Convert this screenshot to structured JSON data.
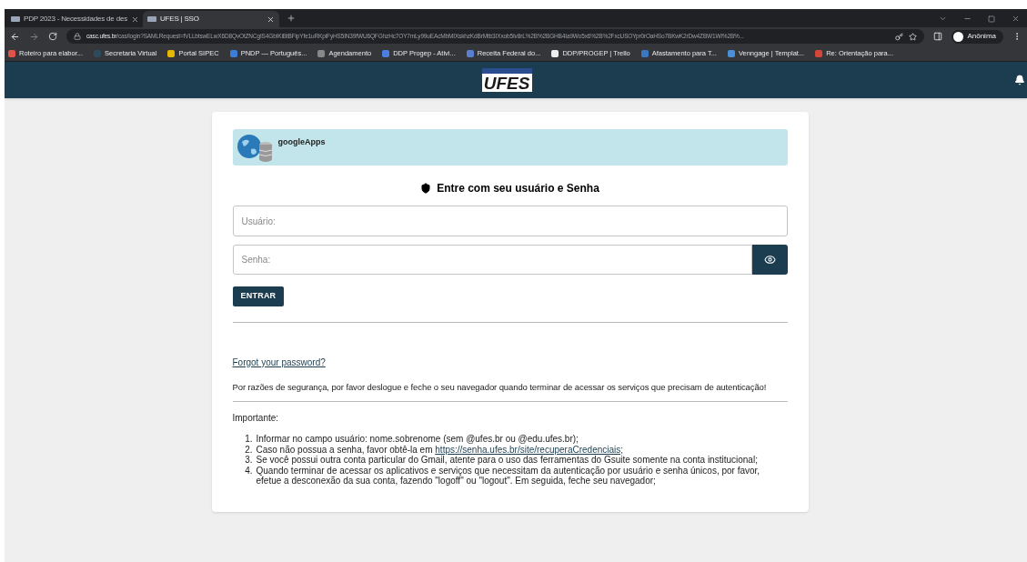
{
  "browser": {
    "tabs": [
      {
        "title": "PDP 2023 - Necessidades de des",
        "selected": false
      },
      {
        "title": "UFES | SSO",
        "selected": true
      }
    ],
    "address": {
      "host": "casc.ufes.br",
      "path": "/cas/login?SAMLRequest=fVLLbtswELwX6D8QvOtZNCgIS4GbIKiBtBFipYfe1uRKpiFyHS5IN39fWU6QFGhzHc7OY7mLy99uEAcMbMIXskhzKdBrMtb3IXxob5Iv8rL%2B%2BGHB4Ia9Wo5x6%2B%2FxcUSOYpr0rOaHSo7BKwK2rDw4ZBW1Wi%2B%..."
    },
    "profile_label": "Anônima",
    "bookmarks": [
      {
        "label": "Roteiro para elabor..."
      },
      {
        "label": "Secretaria Virtual"
      },
      {
        "label": "Portal SIPEC"
      },
      {
        "label": "PNDP — Português..."
      },
      {
        "label": "Agendamento"
      },
      {
        "label": "DDP Progep - Ativi..."
      },
      {
        "label": "Receita Federal do..."
      },
      {
        "label": "DDP/PROGEP | Trello"
      },
      {
        "label": "Afastamento para T..."
      },
      {
        "label": "Venngage | Templat..."
      },
      {
        "label": "Re: Orientação para..."
      }
    ]
  },
  "header": {
    "logo": "UFES"
  },
  "login": {
    "app_name": "googleApps",
    "heading": "Entre com seu usuário e Senha",
    "username": {
      "placeholder": "Usuário:"
    },
    "password": {
      "placeholder": "Senha:"
    },
    "submit": "ENTRAR",
    "forgot_link": "Forgot your password?",
    "security_notice": "Por razões de segurança, por favor deslogue e feche o seu navegador quando terminar de acessar os serviços que precisam de autenticação!",
    "important_label": "Importante:",
    "notes": [
      {
        "marker": "1.",
        "text": "Informar no campo usuário: nome.sobrenome (sem @ufes.br ou @edu.ufes.br);"
      },
      {
        "marker": "2.",
        "text": "Caso não possua a senha, favor obtê-la em",
        "link": "https://senha.ufes.br/site/recuperaCredenciais;"
      },
      {
        "marker": "3.",
        "text": "Se você possui outra conta particular do Gmail, atente para o uso das ferramentas do Gsuite somente na conta institucional;"
      },
      {
        "marker": "4.",
        "text": "Quando terminar de acessar os aplicativos e serviços que necessitam da autenticação por usuário e senha únicos, por favor, efetue a desconexão da sua conta, fazendo \"logoff\" ou \"logout\". Em seguida, feche seu navegador;"
      }
    ]
  }
}
